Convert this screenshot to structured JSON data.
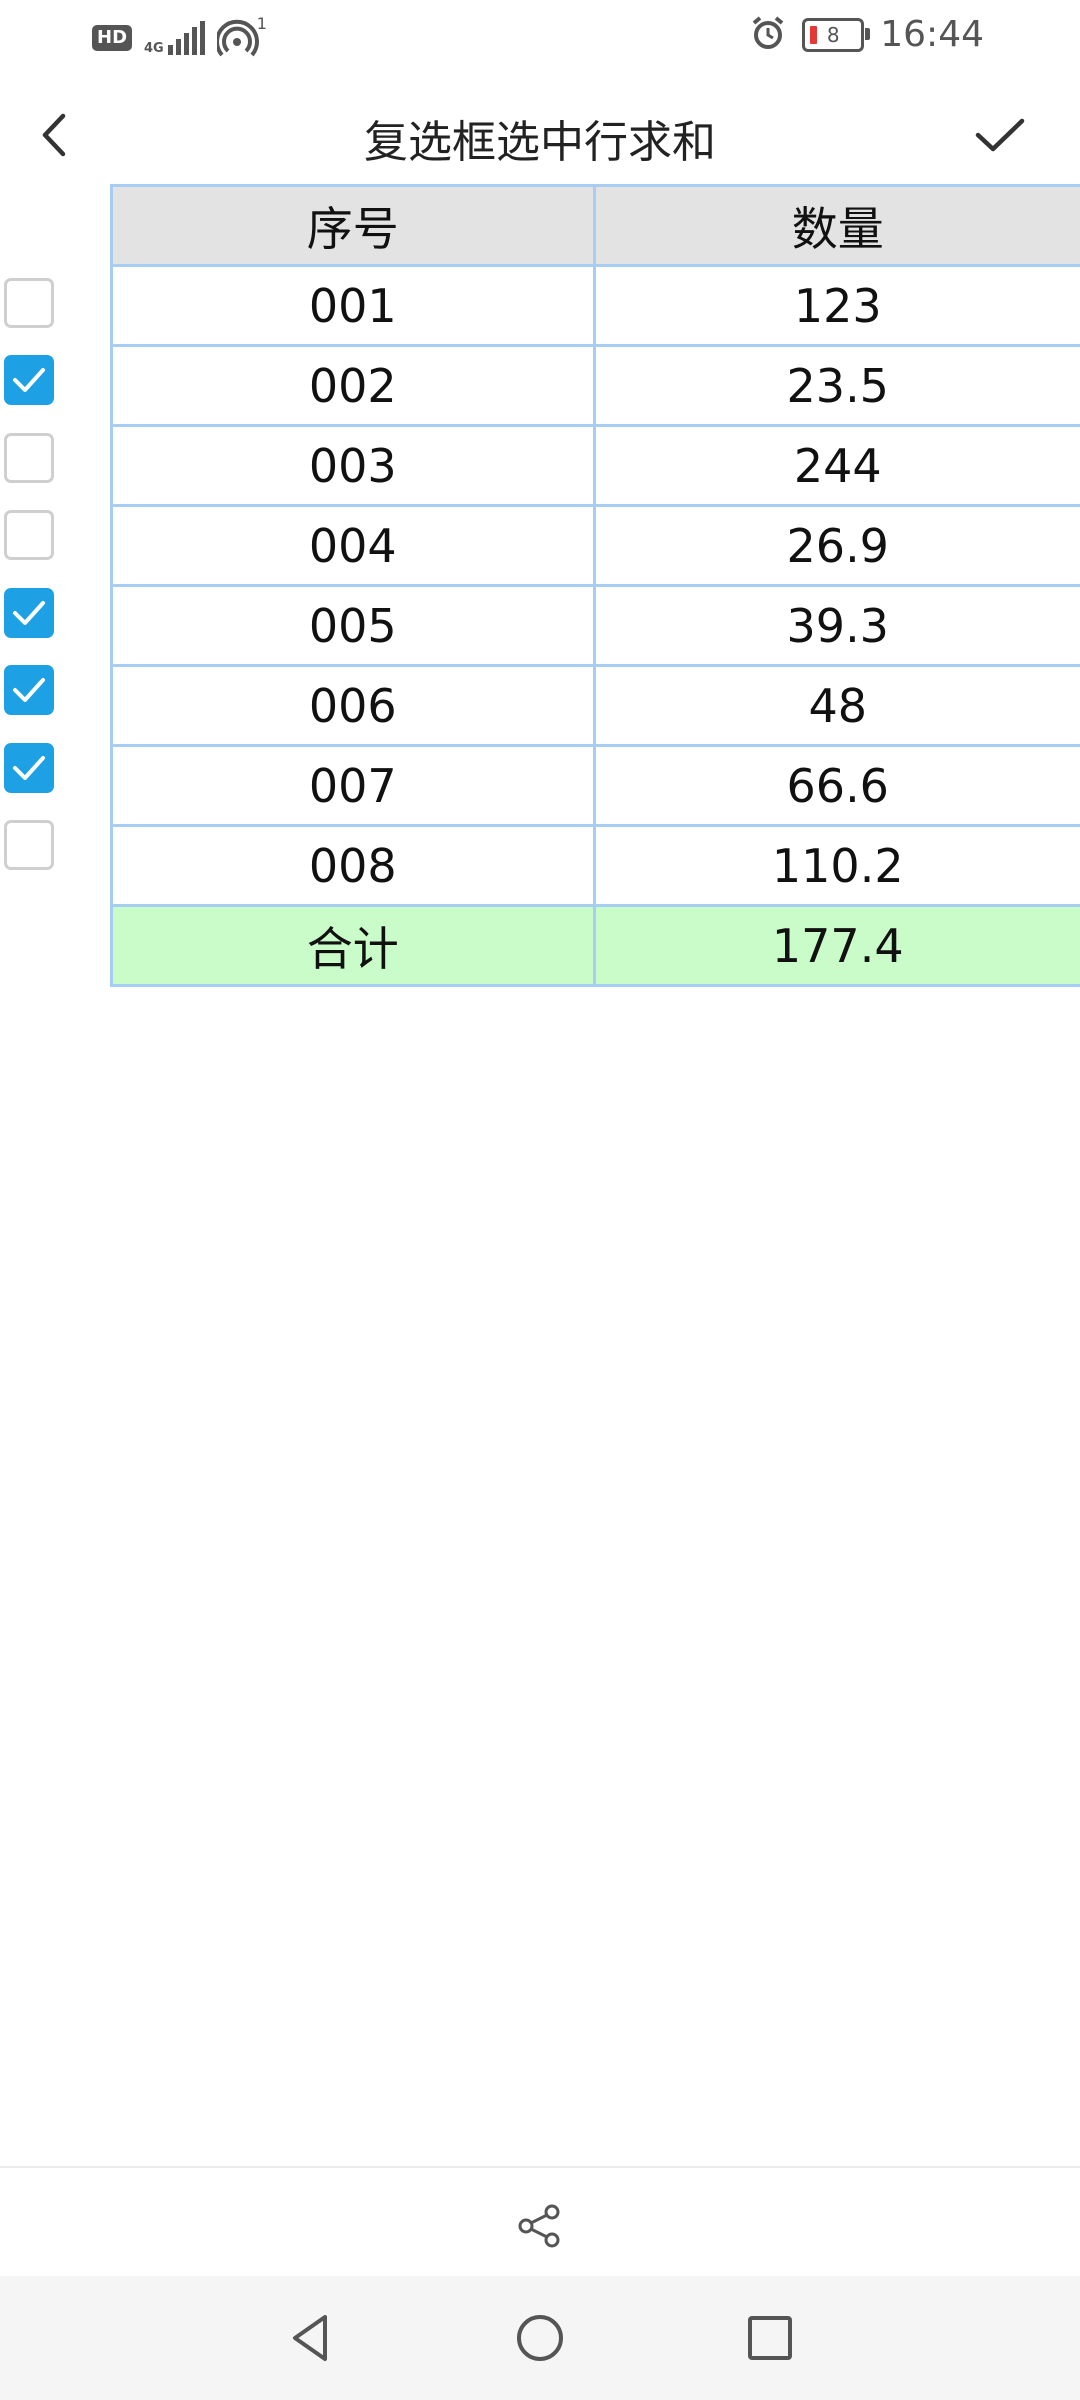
{
  "status_bar": {
    "left_badge": "HD",
    "network": "4G",
    "hotspot_count": "1",
    "battery_level": "8",
    "time": "16:44"
  },
  "header": {
    "title": "复选框选中行求和",
    "back_icon": "chevron-left-icon",
    "confirm_icon": "check-icon"
  },
  "table": {
    "columns": [
      "序号",
      "数量"
    ],
    "rows": [
      {
        "id": "001",
        "qty": "123",
        "checked": false
      },
      {
        "id": "002",
        "qty": "23.5",
        "checked": true
      },
      {
        "id": "003",
        "qty": "244",
        "checked": false
      },
      {
        "id": "004",
        "qty": "26.9",
        "checked": false
      },
      {
        "id": "005",
        "qty": "39.3",
        "checked": true
      },
      {
        "id": "006",
        "qty": "48",
        "checked": true
      },
      {
        "id": "007",
        "qty": "66.6",
        "checked": true
      },
      {
        "id": "008",
        "qty": "110.2",
        "checked": false
      }
    ],
    "total_label": "合计",
    "total_value": "177.4"
  },
  "colors": {
    "grid_line": "#a8cdf3",
    "header_bg": "#e3e3e3",
    "total_bg": "#c9fcc9",
    "checkbox_on": "#1da1e4"
  },
  "bottom": {
    "share_icon": "share-icon",
    "nav": [
      "back-triangle-icon",
      "home-circle-icon",
      "recents-square-icon"
    ]
  }
}
